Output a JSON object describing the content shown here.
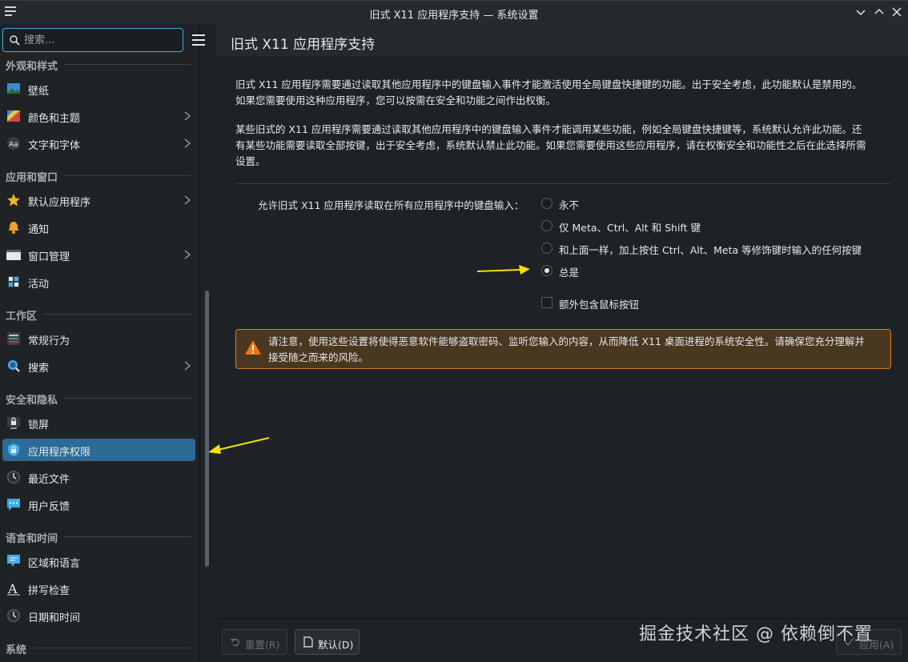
{
  "window": {
    "title": "旧式 X11 应用程序支持 — 系统设置"
  },
  "sidebar": {
    "search_placeholder": "搜索...",
    "categories": [
      {
        "label": "外观和样式"
      },
      {
        "label": "应用和窗口"
      },
      {
        "label": "工作区"
      },
      {
        "label": "安全和隐私"
      },
      {
        "label": "语言和时间"
      },
      {
        "label": "系统"
      }
    ],
    "items": [
      {
        "label": "壁纸",
        "icon": "wallpaper-icon"
      },
      {
        "label": "颜色和主题",
        "icon": "colors-icon",
        "has_submenu": true
      },
      {
        "label": "文字和字体",
        "icon": "fonts-icon",
        "has_submenu": true
      },
      {
        "label": "默认应用程序",
        "icon": "star-icon",
        "has_submenu": true
      },
      {
        "label": "通知",
        "icon": "bell-icon"
      },
      {
        "label": "窗口管理",
        "icon": "window-icon",
        "has_submenu": true
      },
      {
        "label": "活动",
        "icon": "activities-icon"
      },
      {
        "label": "常规行为",
        "icon": "general-behavior-icon"
      },
      {
        "label": "搜索",
        "icon": "search-icon",
        "has_submenu": true
      },
      {
        "label": "锁屏",
        "icon": "lock-screen-icon"
      },
      {
        "label": "应用程序权限",
        "icon": "app-permissions-icon",
        "selected": true
      },
      {
        "label": "最近文件",
        "icon": "clock-icon"
      },
      {
        "label": "用户反馈",
        "icon": "feedback-icon"
      },
      {
        "label": "区域和语言",
        "icon": "region-icon"
      },
      {
        "label": "拼写检查",
        "icon": "spellcheck-icon"
      },
      {
        "label": "日期和时间",
        "icon": "clock-icon"
      }
    ]
  },
  "main": {
    "header": "旧式 X11 应用程序支持",
    "para1_line1": "旧式 X11 应用程序需要通过读取其他应用程序中的键盘输入事件才能激活使用全局键盘快捷键的功能。出于安全考虑，此功能默认是禁用的。",
    "para1_line2": "如果您需要使用这种应用程序，您可以按需在安全和功能之间作出权衡。",
    "para2_line1": "某些旧式的 X11 应用程序需要通过读取其他应用程序中的键盘输入事件才能调用某些功能，例如全局键盘快捷键等，系统默认允许此功能。还",
    "para2_line2": "有某些功能需要读取全部按键，出于安全考虑，系统默认禁止此功能。如果您需要使用这些应用程序，请在权衡安全和功能性之后在此选择所需",
    "para2_line3": "设置。",
    "form_label": "允许旧式 X11 应用程序读取在所有应用程序中的键盘输入：",
    "options": [
      {
        "label": "永不",
        "checked": false
      },
      {
        "label": "仅 Meta、Ctrl、Alt 和 Shift 键",
        "checked": false
      },
      {
        "label": "和上面一样，加上按住 Ctrl、Alt、Meta 等修饰键时输入的任何按键",
        "checked": false
      },
      {
        "label": "总是",
        "checked": true
      }
    ],
    "checkbox_label": "额外包含鼠标按钮",
    "checkbox_checked": false,
    "warning_line1": "请注意，使用这些设置将使得恶意软件能够盗取密码、监听您输入的内容，从而降低 X11 桌面进程的系统安全性。请确保您充分理解并",
    "warning_line2": "接受随之而来的风险。"
  },
  "footer": {
    "reset_label": "重置(R)",
    "defaults_label": "默认(D)",
    "apply_label": "应用(A)"
  },
  "watermark": "掘金技术社区 @ 依赖倒不置",
  "colors": {
    "accent": "#3daee9",
    "selected": "#2d6b96",
    "warning_border": "#d6801f",
    "annotation_arrow": "#f5e000"
  }
}
